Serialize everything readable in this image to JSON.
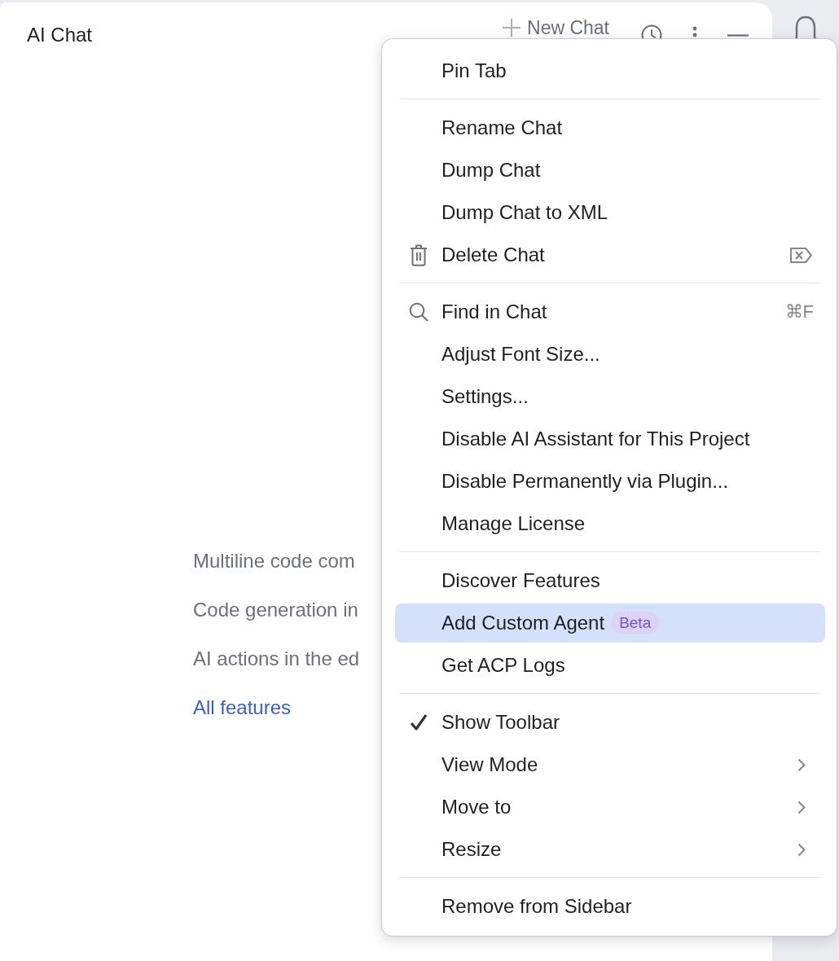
{
  "panel": {
    "title": "AI Chat",
    "new_chat": "New Chat"
  },
  "features": {
    "lines": [
      "Multiline code com",
      "Code generation in",
      "AI actions in the ed"
    ],
    "link": "All features"
  },
  "menu": {
    "sections": [
      {
        "items": [
          {
            "label": "Pin Tab",
            "kind": "plain",
            "selected": false
          }
        ]
      },
      {
        "items": [
          {
            "label": "Rename Chat",
            "kind": "plain",
            "selected": false
          },
          {
            "label": "Dump Chat",
            "kind": "plain",
            "selected": false
          },
          {
            "label": "Dump Chat to XML",
            "kind": "plain",
            "selected": false
          },
          {
            "label": "Delete Chat",
            "kind": "delete",
            "selected": false
          }
        ]
      },
      {
        "items": [
          {
            "label": "Find in Chat",
            "kind": "search",
            "shortcut": "⌘F",
            "selected": false
          },
          {
            "label": "Adjust Font Size...",
            "kind": "plain",
            "selected": false
          },
          {
            "label": "Settings...",
            "kind": "plain",
            "selected": false
          },
          {
            "label": "Disable AI Assistant for This Project",
            "kind": "plain",
            "selected": false
          },
          {
            "label": "Disable Permanently via Plugin...",
            "kind": "plain",
            "selected": false
          },
          {
            "label": "Manage License",
            "kind": "plain",
            "selected": false
          }
        ]
      },
      {
        "items": [
          {
            "label": "Discover Features",
            "kind": "plain",
            "selected": false
          },
          {
            "label": "Add Custom Agent",
            "kind": "plain",
            "badge": "Beta",
            "selected": true
          },
          {
            "label": "Get ACP Logs",
            "kind": "plain",
            "selected": false
          }
        ]
      },
      {
        "items": [
          {
            "label": "Show Toolbar",
            "kind": "toggle",
            "checked": true,
            "selected": false
          },
          {
            "label": "View Mode",
            "kind": "submenu",
            "selected": false
          },
          {
            "label": "Move to",
            "kind": "submenu",
            "selected": false
          },
          {
            "label": "Resize",
            "kind": "submenu",
            "selected": false
          }
        ]
      },
      {
        "items": [
          {
            "label": "Remove from Sidebar",
            "kind": "plain",
            "selected": false
          }
        ]
      }
    ]
  }
}
